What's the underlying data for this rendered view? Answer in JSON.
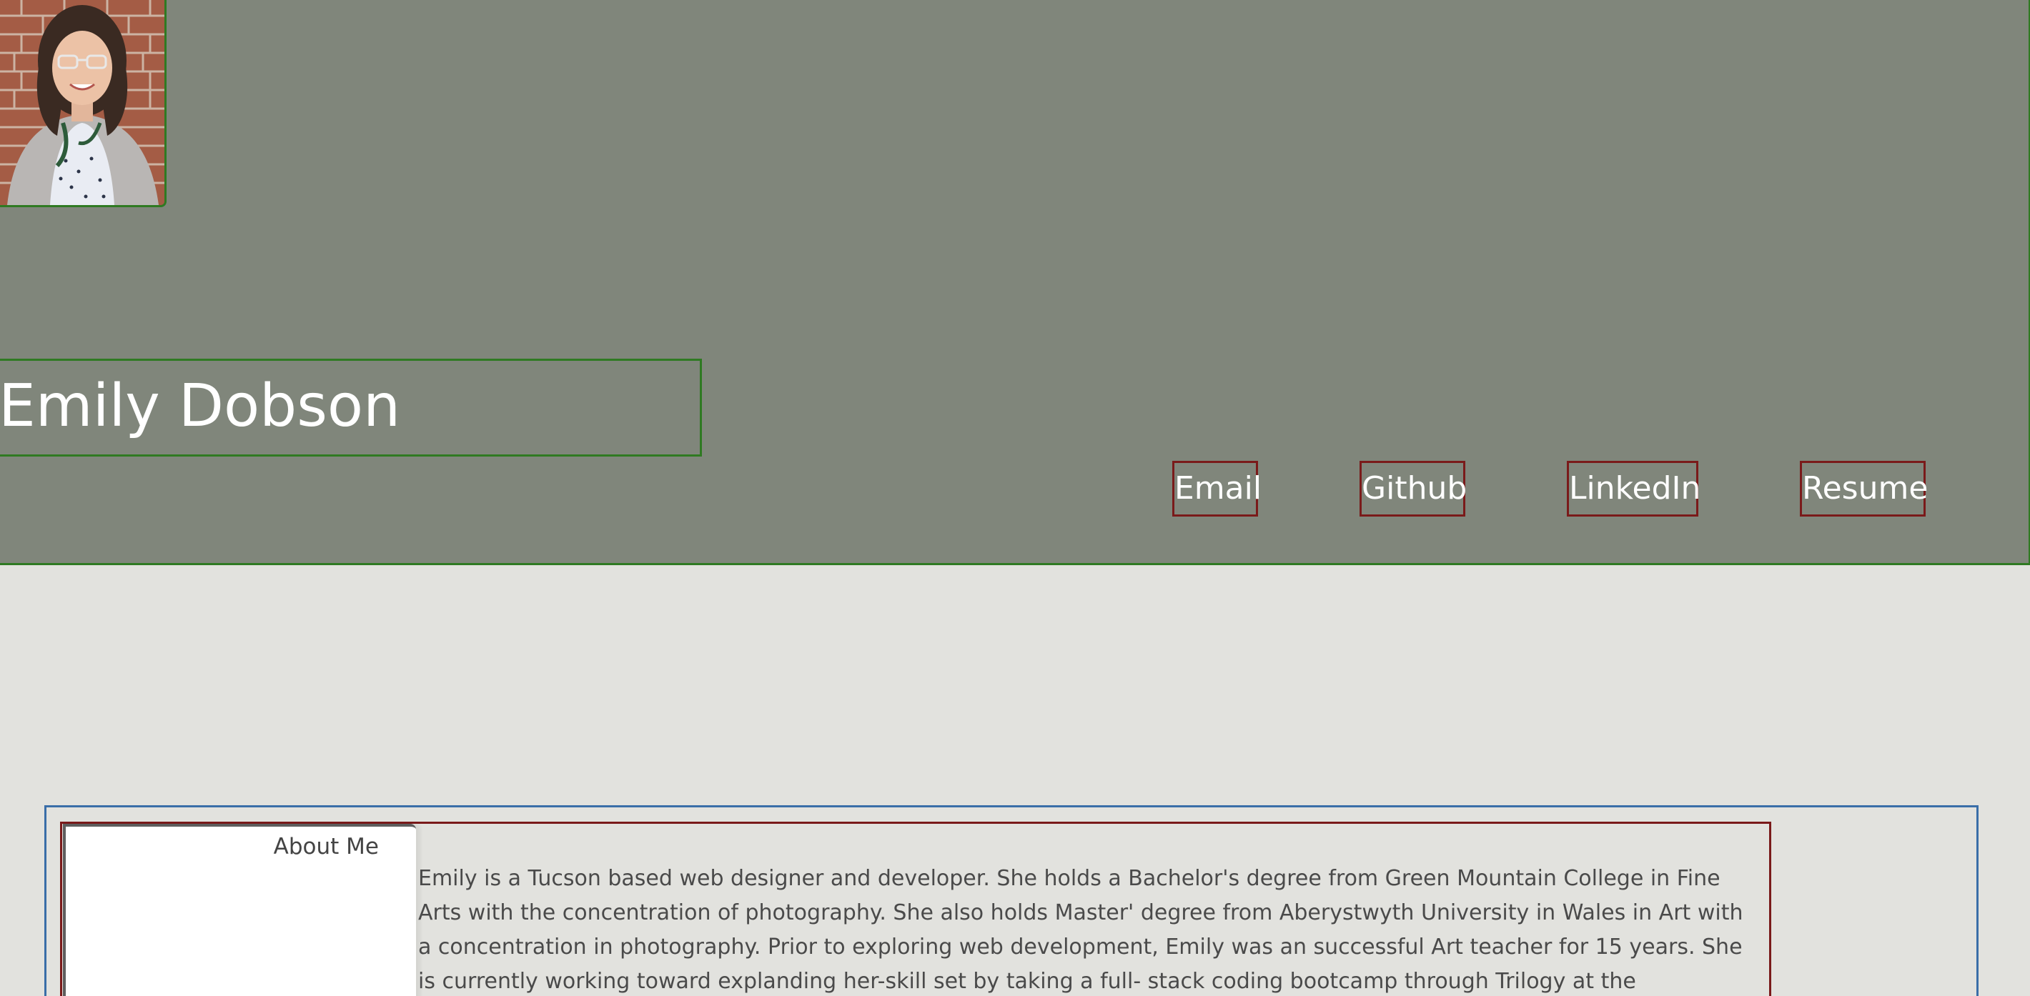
{
  "header": {
    "name": "Emily Dobson",
    "avatar_icon": "profile-photo",
    "nav": {
      "email": "Email",
      "github": "Github",
      "linkedin": "LinkedIn",
      "resume": "Resume"
    }
  },
  "about": {
    "title": "About Me",
    "body": "Emily is a Tucson based web designer and developer. She holds a Bachelor's degree from Green Mountain College in Fine Arts with the concentration of photography. She also holds Master' degree from Aberystwyth University in Wales in Art with a concentration in photography. Prior to exploring web development, Emily was an successful Art teacher for 15 years. She is currently working toward explanding her-skill set by taking a full- stack coding bootcamp through Trilogy at the University of"
  },
  "colors": {
    "header_bg": "#80867b",
    "page_bg": "#e2e2de",
    "green_border": "#2f7a22",
    "maroon_border": "#7a1a1a",
    "blue_border": "#3a6ea8"
  }
}
